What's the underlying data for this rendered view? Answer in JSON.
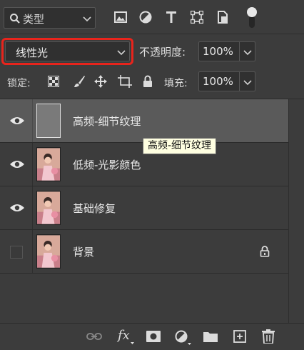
{
  "filter": {
    "kind_label": "类型",
    "icons": [
      "image-filter-icon",
      "adjustment-filter-icon",
      "type-filter-icon",
      "shape-filter-icon",
      "smart-object-filter-icon",
      "filter-toggle"
    ]
  },
  "blend": {
    "mode_value": "线性光",
    "opacity_label": "不透明度:",
    "opacity_value": "100%"
  },
  "lock": {
    "label": "锁定:",
    "fill_label": "填充:",
    "fill_value": "100%"
  },
  "layers": [
    {
      "name": "高频-细节纹理",
      "visible": true,
      "selected": true,
      "locked": false
    },
    {
      "name": "低频-光影颜色",
      "visible": true,
      "selected": false,
      "locked": false
    },
    {
      "name": "基础修复",
      "visible": true,
      "selected": false,
      "locked": false
    },
    {
      "name": "背景",
      "visible": false,
      "selected": false,
      "locked": true
    }
  ],
  "tooltip": {
    "text": "高频-细节纹理"
  },
  "colors": {
    "highlight_border": "#e8241c",
    "panel": "#3c3c3c",
    "selected_row": "#5a5a5a",
    "tooltip_bg": "#ffffe1"
  }
}
